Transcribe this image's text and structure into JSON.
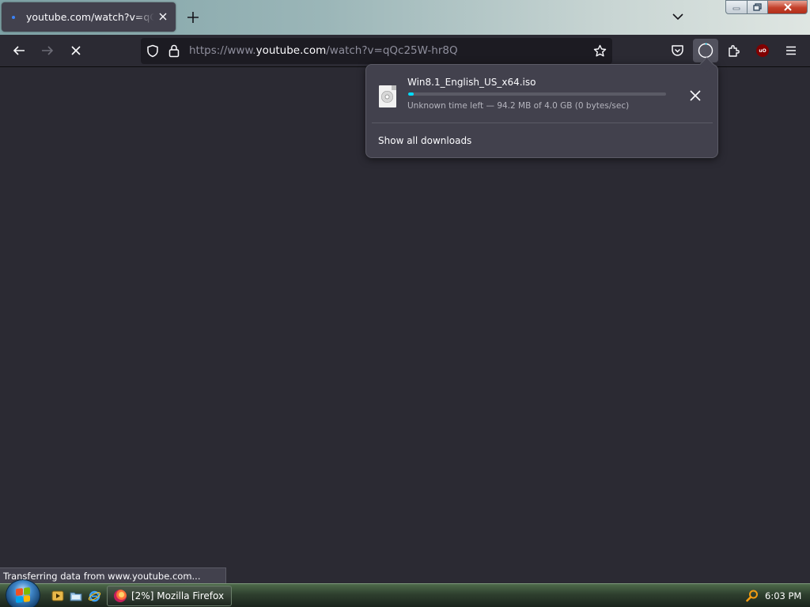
{
  "browser": {
    "tab": {
      "title": "youtube.com/watch?v=qQc25W-hr8Q",
      "favicon_color": "#3b82f6"
    },
    "urlbar": {
      "prefix": "https://www.",
      "host": "youtube.com",
      "path": "/watch?v=qQc25W-hr8Q"
    },
    "accent_color": "#00ddff",
    "page_background": "#2b2a33"
  },
  "downloads_panel": {
    "item": {
      "filename": "Win8.1_English_US_x64.iso",
      "status": "Unknown time left — 94.2 MB of 4.0 GB (0 bytes/sec)",
      "progress_fraction": 0.023
    },
    "show_all_label": "Show all downloads"
  },
  "status_bar": {
    "text": "Transferring data from www.youtube.com..."
  },
  "taskbar": {
    "active_window": "[2%] Mozilla Firefox",
    "clock": "6:03 PM"
  }
}
